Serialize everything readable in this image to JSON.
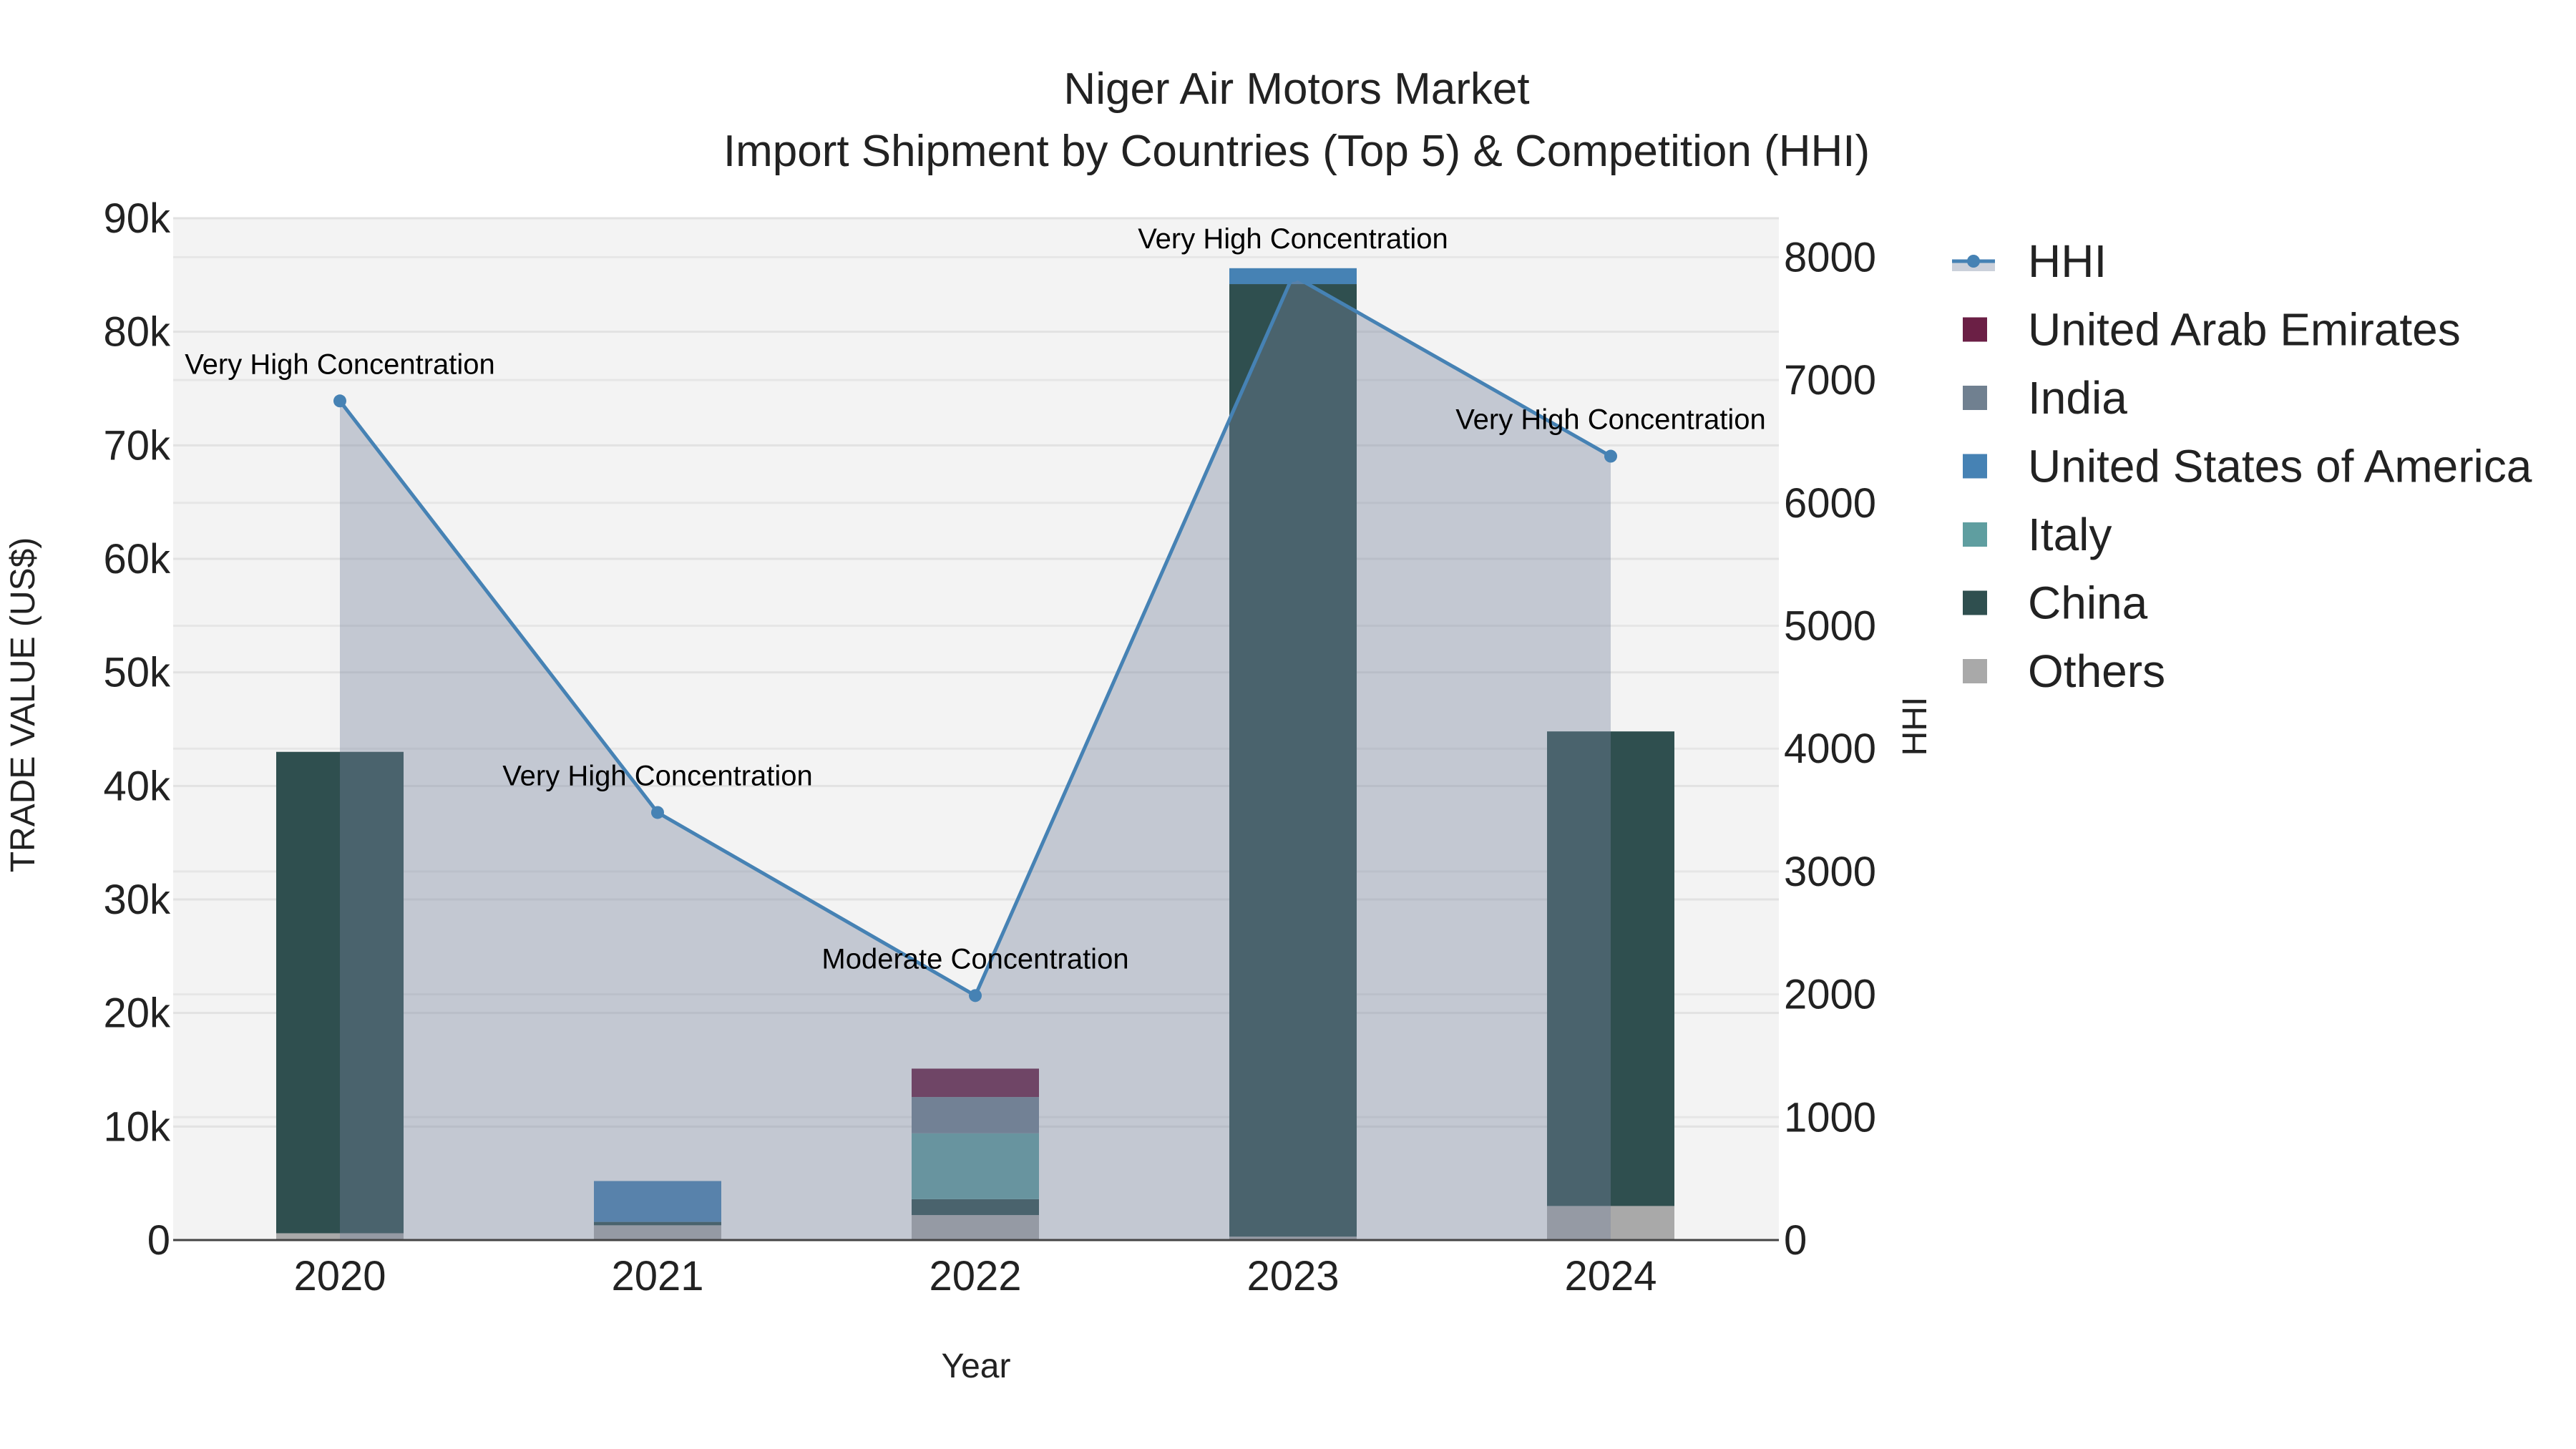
{
  "chart_data": {
    "type": "bar",
    "title": "Niger Air Motors Market",
    "subtitle": "Import Shipment by Countries (Top 5) & Competition (HHI)",
    "xlabel": "Year",
    "ylabel": "TRADE VALUE (US$)",
    "y2label": "HHI",
    "categories": [
      "2020",
      "2021",
      "2022",
      "2023",
      "2024"
    ],
    "ylim": [
      0,
      90000
    ],
    "y2lim": [
      0,
      8300
    ],
    "yticks": [
      "0",
      "10k",
      "20k",
      "30k",
      "40k",
      "50k",
      "60k",
      "70k",
      "80k",
      "90k"
    ],
    "y2ticks": [
      "0",
      "1000",
      "2000",
      "3000",
      "4000",
      "5000",
      "6000",
      "7000",
      "8000"
    ],
    "series": [
      {
        "name": "Others",
        "color": "#a9a9a9",
        "values": [
          600,
          1300,
          2200,
          300,
          3000
        ]
      },
      {
        "name": "China",
        "color": "#2f4f4f",
        "values": [
          42400,
          300,
          1400,
          83900,
          41800
        ]
      },
      {
        "name": "Italy",
        "color": "#5f9ea0",
        "values": [
          0,
          0,
          5800,
          0,
          0
        ]
      },
      {
        "name": "United States of America",
        "color": "#4682b4",
        "values": [
          0,
          3600,
          0,
          1400,
          0
        ]
      },
      {
        "name": "India",
        "color": "#708090",
        "values": [
          0,
          0,
          3200,
          0,
          0
        ]
      },
      {
        "name": "United Arab Emirates",
        "color": "#6b1f45",
        "values": [
          0,
          0,
          2500,
          0,
          0
        ]
      }
    ],
    "hhi": {
      "name": "HHI",
      "color": "#4682b4",
      "values": [
        6830,
        3480,
        1990,
        7850,
        6380
      ],
      "annotations": [
        "Very High Concentration",
        "Very High Concentration",
        "Moderate Concentration",
        "Very High Concentration",
        "Very High Concentration"
      ]
    },
    "legend": [
      "HHI",
      "United Arab Emirates",
      "India",
      "United States of America",
      "Italy",
      "China",
      "Others"
    ],
    "legend_position": "right",
    "grid": true
  }
}
